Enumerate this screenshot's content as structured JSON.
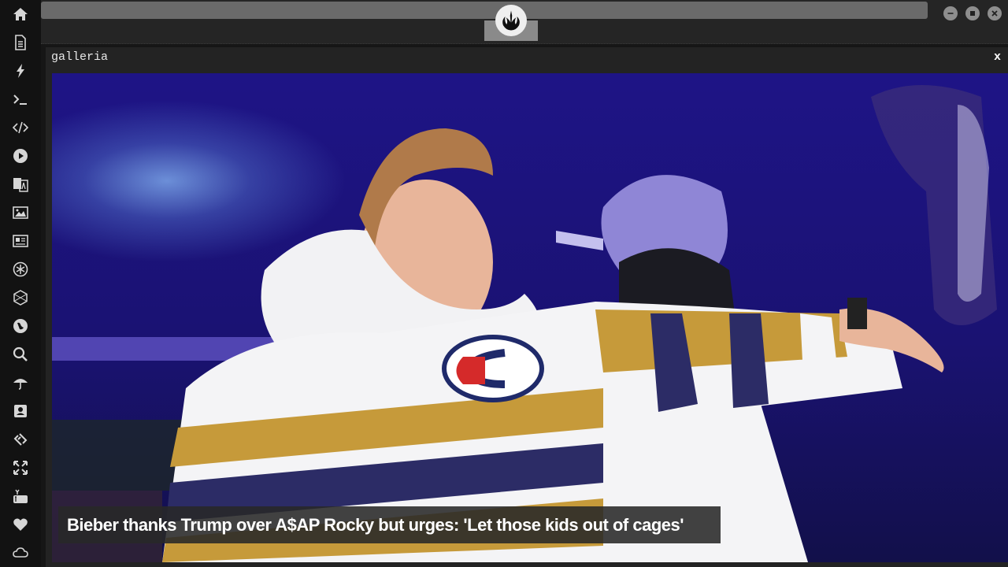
{
  "window": {
    "title": "galleria",
    "close_label": "x"
  },
  "gallery": {
    "caption": "Bieber thanks Trump over A$AP Rocky but urges: 'Let those kids out of cages'"
  },
  "sidebar": {
    "items": [
      {
        "name": "home",
        "icon": "home-icon"
      },
      {
        "name": "document",
        "icon": "document-icon"
      },
      {
        "name": "flash",
        "icon": "lightning-icon"
      },
      {
        "name": "terminal",
        "icon": "terminal-icon"
      },
      {
        "name": "code",
        "icon": "code-icon"
      },
      {
        "name": "play",
        "icon": "play-icon"
      },
      {
        "name": "translate",
        "icon": "translate-icon"
      },
      {
        "name": "image",
        "icon": "image-icon"
      },
      {
        "name": "news",
        "icon": "newspaper-icon"
      },
      {
        "name": "rebel",
        "icon": "rebel-icon"
      },
      {
        "name": "hexagon",
        "icon": "hexagon-icon"
      },
      {
        "name": "globe",
        "icon": "globe-icon"
      },
      {
        "name": "search",
        "icon": "search-icon"
      },
      {
        "name": "umbrella",
        "icon": "umbrella-icon"
      },
      {
        "name": "contact",
        "icon": "contact-card-icon"
      },
      {
        "name": "link",
        "icon": "link-icon"
      },
      {
        "name": "expand",
        "icon": "expand-icon"
      },
      {
        "name": "youtube",
        "icon": "youtube-icon"
      },
      {
        "name": "heart",
        "icon": "heart-icon"
      },
      {
        "name": "cloud",
        "icon": "cloud-icon"
      }
    ]
  },
  "titlebar": {
    "logo_icon": "rebel-alliance-icon",
    "buttons": [
      "minimize-icon",
      "maximize-icon",
      "close-icon"
    ]
  },
  "colors": {
    "sidebar_bg": "#121212",
    "topbar_bg": "#252525",
    "address_bar": "#6a6a6a",
    "window_bg": "#232323"
  }
}
